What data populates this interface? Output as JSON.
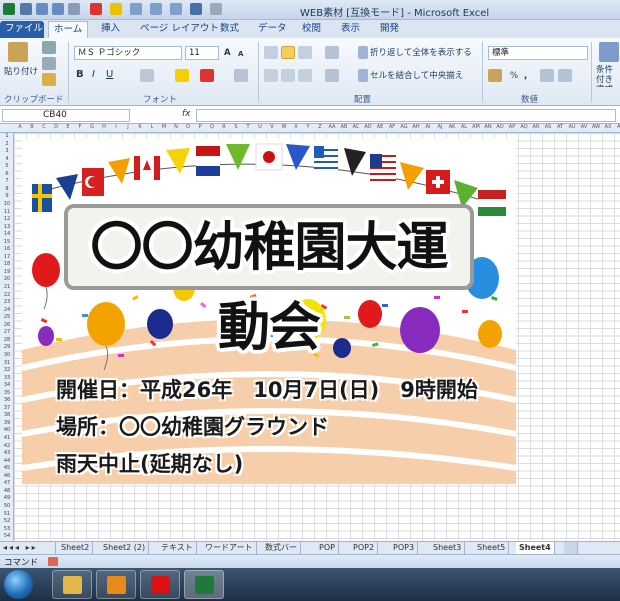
{
  "window": {
    "title": "WEB素材 [互換モード] - Microsoft Excel"
  },
  "ribbon_tabs": [
    {
      "label": "ファイル"
    },
    {
      "label": "ホーム"
    },
    {
      "label": "挿入"
    },
    {
      "label": "ページ レイアウト"
    },
    {
      "label": "数式"
    },
    {
      "label": "データ"
    },
    {
      "label": "校閲"
    },
    {
      "label": "表示"
    },
    {
      "label": "開発"
    }
  ],
  "ribbon": {
    "clipboard": {
      "label": "クリップボード",
      "paste_label": "貼り付け"
    },
    "font": {
      "label": "フォント",
      "font_name": "ＭＳ Ｐゴシック",
      "font_size": "11"
    },
    "alignment": {
      "label": "配置",
      "wrap_text": "折り返して全体を表示する",
      "merge_center": "セルを結合して中央揃え"
    },
    "number": {
      "label": "数値",
      "format": "標準"
    },
    "styles": {
      "conditional_label": "条件付き 書式"
    }
  },
  "formula_bar": {
    "name_box": "CB40",
    "fx": "fx",
    "value": ""
  },
  "poster": {
    "heading": "〇〇幼稚園大運動会",
    "line1": "開催日：平成26年　10月7日(日)　9時開始",
    "line2": "場所：〇〇幼稚園グラウンド",
    "line3": "雨天中止(延期なし)"
  },
  "sheet_tabs": [
    {
      "label": "Sheet2"
    },
    {
      "label": "Sheet2 (2)"
    },
    {
      "label": "テキスト"
    },
    {
      "label": "ワードアート"
    },
    {
      "label": "数式バー"
    },
    {
      "label": "POP"
    },
    {
      "label": "POP2"
    },
    {
      "label": "POP3"
    },
    {
      "label": "Sheet3"
    },
    {
      "label": "Sheet5"
    },
    {
      "label": "Sheet4"
    }
  ],
  "status": {
    "mode": "コマンド"
  },
  "colors": {
    "accent": "#2a5ea8",
    "track": "#f5c9a0",
    "heading_border": "#9a9a9a"
  },
  "taskbar_apps": [
    "explorer-icon",
    "outlook-icon",
    "app-icon",
    "excel-icon"
  ]
}
